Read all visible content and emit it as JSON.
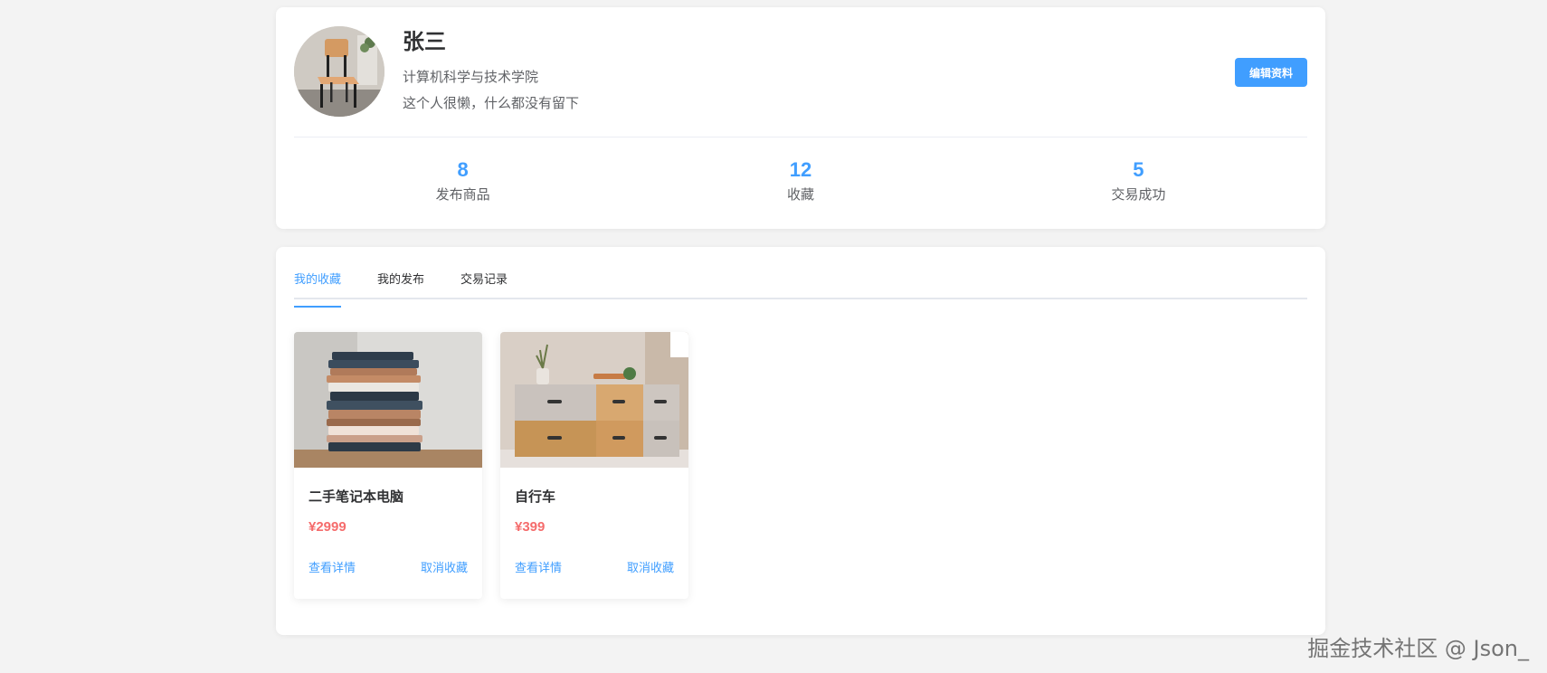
{
  "profile": {
    "name": "张三",
    "department": "计算机科学与技术学院",
    "bio": "这个人很懒，什么都没有留下",
    "edit_label": "编辑资料"
  },
  "stats": [
    {
      "value": "8",
      "label": "发布商品"
    },
    {
      "value": "12",
      "label": "收藏"
    },
    {
      "value": "5",
      "label": "交易成功"
    }
  ],
  "tabs": [
    {
      "label": "我的收藏"
    },
    {
      "label": "我的发布"
    },
    {
      "label": "交易记录"
    }
  ],
  "products": [
    {
      "name": "二手笔记本电脑",
      "price": "¥2999",
      "view_label": "查看详情",
      "unfavorite_label": "取消收藏"
    },
    {
      "name": "自行车",
      "price": "¥399",
      "view_label": "查看详情",
      "unfavorite_label": "取消收藏"
    }
  ],
  "watermark": "掘金技术社区 @ Json_",
  "colors": {
    "accent": "#409eff",
    "price": "#f56c6c",
    "background": "#f3f3f3"
  }
}
